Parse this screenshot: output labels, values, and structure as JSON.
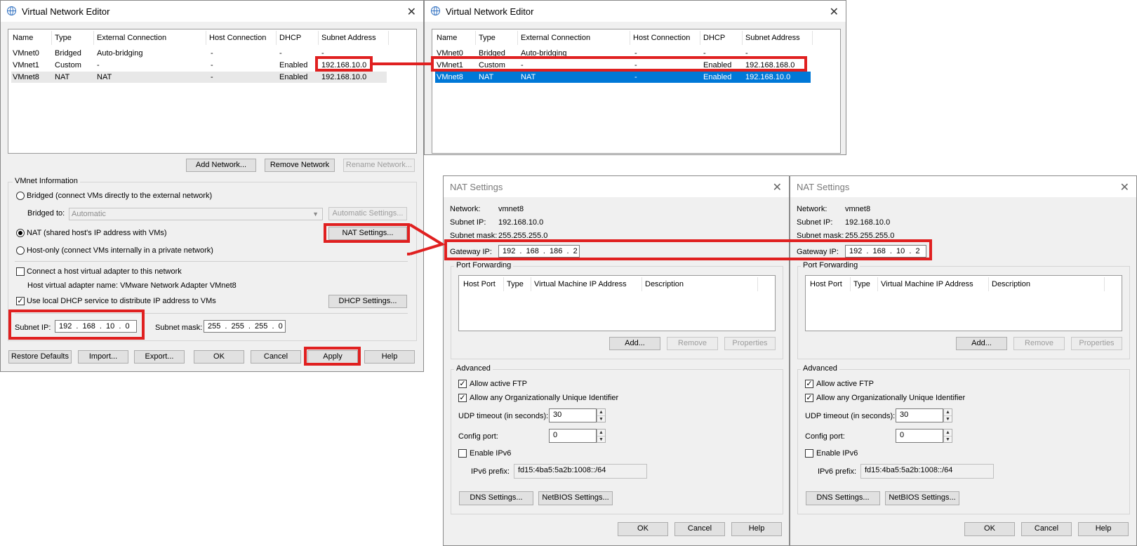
{
  "editor_left": {
    "title": "Virtual Network Editor",
    "columns": [
      "Name",
      "Type",
      "External Connection",
      "Host Connection",
      "DHCP",
      "Subnet Address"
    ],
    "rows": [
      [
        "VMnet0",
        "Bridged",
        "Auto-bridging",
        "-",
        "-",
        "-"
      ],
      [
        "VMnet1",
        "Custom",
        "-",
        "-",
        "Enabled",
        "192.168.10.0"
      ],
      [
        "VMnet8",
        "NAT",
        "NAT",
        "-",
        "Enabled",
        "192.168.10.0"
      ]
    ],
    "add_network": "Add Network...",
    "remove_network": "Remove Network",
    "rename_network": "Rename Network...",
    "vmnet_info": "VMnet Information",
    "bridged_radio": "Bridged (connect VMs directly to the external network)",
    "bridged_to_label": "Bridged to:",
    "bridged_to_value": "Automatic",
    "automatic_settings": "Automatic Settings...",
    "nat_radio": "NAT (shared host's IP address with VMs)",
    "nat_settings": "NAT Settings...",
    "hostonly_radio": "Host-only (connect VMs internally in a private network)",
    "connect_adapter": "Connect a host virtual adapter to this network",
    "adapter_name": "Host virtual adapter name: VMware Network Adapter VMnet8",
    "use_dhcp": "Use local DHCP service to distribute IP address to VMs",
    "dhcp_settings": "DHCP Settings...",
    "subnet_ip_label": "Subnet IP:",
    "subnet_ip_value": "192 . 168 . 10  .  0",
    "subnet_mask_label": "Subnet mask:",
    "subnet_mask_value": "255 . 255 . 255 .  0",
    "restore_defaults": "Restore Defaults",
    "import": "Import...",
    "export": "Export...",
    "ok": "OK",
    "cancel": "Cancel",
    "apply": "Apply",
    "help": "Help"
  },
  "editor_right": {
    "title": "Virtual Network Editor",
    "columns": [
      "Name",
      "Type",
      "External Connection",
      "Host Connection",
      "DHCP",
      "Subnet Address"
    ],
    "rows": [
      [
        "VMnet0",
        "Bridged",
        "Auto-bridging",
        "-",
        "-",
        "-"
      ],
      [
        "VMnet1",
        "Custom",
        "-",
        "-",
        "Enabled",
        "192.168.168.0"
      ],
      [
        "VMnet8",
        "NAT",
        "NAT",
        "-",
        "Enabled",
        "192.168.10.0"
      ]
    ],
    "selected_row": "VMnet8"
  },
  "nat_left": {
    "title": "NAT Settings",
    "network_label": "Network:",
    "network_value": "vmnet8",
    "subnet_ip_label": "Subnet IP:",
    "subnet_ip_value": "192.168.10.0",
    "subnet_mask_label": "Subnet mask:",
    "subnet_mask_value": "255.255.255.0",
    "gateway_label": "Gateway IP:",
    "gateway_value": "192 . 168 . 186 .  2",
    "port_forwarding": "Port Forwarding",
    "pf_columns": [
      "Host Port",
      "Type",
      "Virtual Machine IP Address",
      "Description"
    ],
    "add": "Add...",
    "remove": "Remove",
    "properties": "Properties",
    "advanced": "Advanced",
    "allow_ftp": "Allow active FTP",
    "allow_oui": "Allow any Organizationally Unique Identifier",
    "udp_label": "UDP timeout (in seconds):",
    "udp_value": "30",
    "config_port_label": "Config port:",
    "config_port_value": "0",
    "enable_ipv6": "Enable IPv6",
    "ipv6_prefix_label": "IPv6 prefix:",
    "ipv6_prefix_value": "fd15:4ba5:5a2b:1008::/64",
    "dns_settings": "DNS Settings...",
    "netbios_settings": "NetBIOS Settings...",
    "ok": "OK",
    "cancel": "Cancel",
    "help": "Help"
  },
  "nat_right": {
    "title": "NAT Settings",
    "network_label": "Network:",
    "network_value": "vmnet8",
    "subnet_ip_label": "Subnet IP:",
    "subnet_ip_value": "192.168.10.0",
    "subnet_mask_label": "Subnet mask:",
    "subnet_mask_value": "255.255.255.0",
    "gateway_label": "Gateway IP:",
    "gateway_value": "192 . 168 . 10  .  2",
    "port_forwarding": "Port Forwarding",
    "pf_columns": [
      "Host Port",
      "Type",
      "Virtual Machine IP Address",
      "Description"
    ],
    "add": "Add...",
    "remove": "Remove",
    "properties": "Properties",
    "advanced": "Advanced",
    "allow_ftp": "Allow active FTP",
    "allow_oui": "Allow any Organizationally Unique Identifier",
    "udp_label": "UDP timeout (in seconds):",
    "udp_value": "30",
    "config_port_label": "Config port:",
    "config_port_value": "0",
    "enable_ipv6": "Enable IPv6",
    "ipv6_prefix_label": "IPv6 prefix:",
    "ipv6_prefix_value": "fd15:4ba5:5a2b:1008::/64",
    "dns_settings": "DNS Settings...",
    "netbios_settings": "NetBIOS Settings...",
    "ok": "OK",
    "cancel": "Cancel",
    "help": "Help"
  },
  "colors": {
    "highlight": "#e02020",
    "selection": "#0078d7"
  }
}
